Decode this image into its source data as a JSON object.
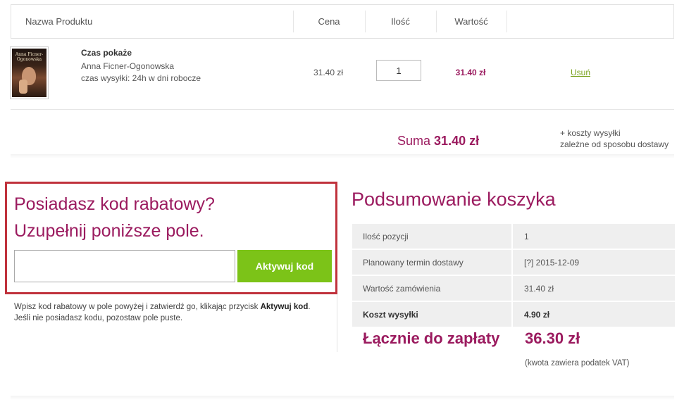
{
  "cart": {
    "headers": {
      "name": "Nazwa Produktu",
      "price": "Cena",
      "qty": "Ilość",
      "value": "Wartość"
    },
    "item": {
      "cover_title": "Anna Ficner-Ogonowska",
      "title": "Czas pokaże",
      "author": "Anna Ficner-Ogonowska",
      "shipping": "czas wysyłki: 24h w dni robocze",
      "price": "31.40 zł",
      "quantity": "1",
      "value": "31.40 zł",
      "remove_label": "Usuń"
    },
    "sum_label": "Suma",
    "sum_value": "31.40 zł",
    "shipping_note_line1": "+ koszty wysyłki",
    "shipping_note_line2": "zależne od sposobu dostawy"
  },
  "coupon": {
    "heading_line1": "Posiadasz kod rabatowy?",
    "heading_line2": "Uzupełnij poniższe pole.",
    "input_value": "",
    "button_label": "Aktywuj kod",
    "help_part1": "Wpisz kod rabatowy w pole powyżej i zatwierdź go, klikając przycisk ",
    "help_bold": "Aktywuj kod",
    "help_part2": ". Jeśli nie posiadasz kodu, pozostaw pole puste."
  },
  "summary": {
    "title": "Podsumowanie koszyka",
    "rows": [
      {
        "label": "Ilość pozycji",
        "value": "1"
      },
      {
        "label": "Planowany termin dostawy",
        "value": "[?] 2015-12-09"
      },
      {
        "label": "Wartość zamówienia",
        "value": "31.40 zł"
      },
      {
        "label": "Koszt wysyłki",
        "value": "4.90 zł"
      }
    ],
    "total_label": "Łącznie do zapłaty",
    "total_value": "36.30 zł",
    "vat_note": "(kwota zawiera podatek VAT)"
  },
  "colors": {
    "accent": "#9b1b5f",
    "button": "#7cc318",
    "link": "#7aa21f",
    "coupon_border": "#c0323c"
  }
}
